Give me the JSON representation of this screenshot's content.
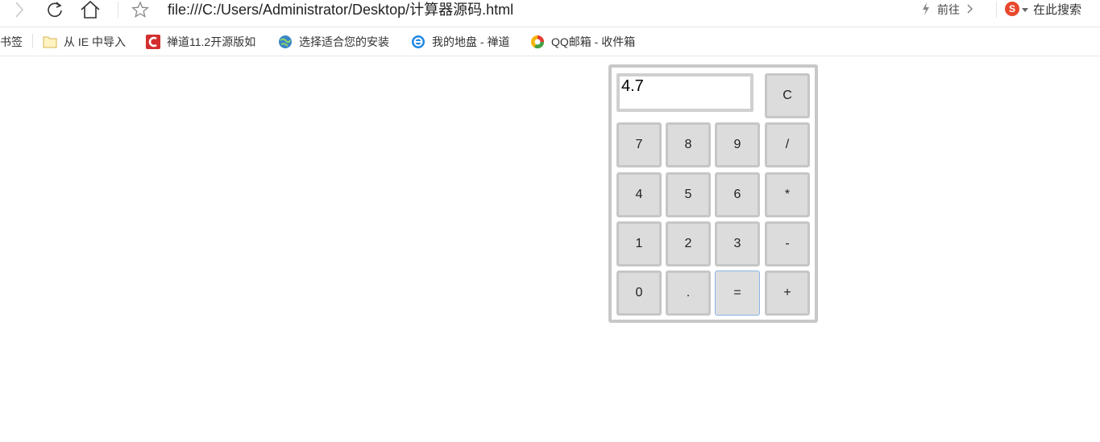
{
  "browser": {
    "url": "file:///C:/Users/Administrator/Desktop/计算器源码.html",
    "goto_label": "前往",
    "search_label": "在此搜索",
    "search_logo": "S"
  },
  "bookmarks": [
    {
      "label": "书签",
      "icon": "none"
    },
    {
      "label": "从 IE 中导入",
      "icon": "folder-icon"
    },
    {
      "label": "禅道11.2开源版如",
      "icon": "zentao-icon"
    },
    {
      "label": "选择适合您的安装",
      "icon": "globe-icon"
    },
    {
      "label": "我的地盘 - 禅道",
      "icon": "ie-icon"
    },
    {
      "label": "QQ邮箱 - 收件箱",
      "icon": "qqmail-icon"
    }
  ],
  "calculator": {
    "display_value": "4.7",
    "keys": [
      {
        "label": "C",
        "name": "clear-key"
      },
      {
        "label": "7",
        "name": "digit-7-key"
      },
      {
        "label": "8",
        "name": "digit-8-key"
      },
      {
        "label": "9",
        "name": "digit-9-key"
      },
      {
        "label": "/",
        "name": "divide-key"
      },
      {
        "label": "4",
        "name": "digit-4-key"
      },
      {
        "label": "5",
        "name": "digit-5-key"
      },
      {
        "label": "6",
        "name": "digit-6-key"
      },
      {
        "label": "*",
        "name": "multiply-key"
      },
      {
        "label": "1",
        "name": "digit-1-key"
      },
      {
        "label": "2",
        "name": "digit-2-key"
      },
      {
        "label": "3",
        "name": "digit-3-key"
      },
      {
        "label": "-",
        "name": "subtract-key"
      },
      {
        "label": "0",
        "name": "digit-0-key"
      },
      {
        "label": ".",
        "name": "decimal-key"
      },
      {
        "label": "=",
        "name": "equals-key"
      },
      {
        "label": "+",
        "name": "add-key"
      }
    ]
  },
  "colors": {
    "key_bg": "#dcdcdc",
    "key_border": "#c6c6c6",
    "focus_border": "#8ab4e8"
  }
}
